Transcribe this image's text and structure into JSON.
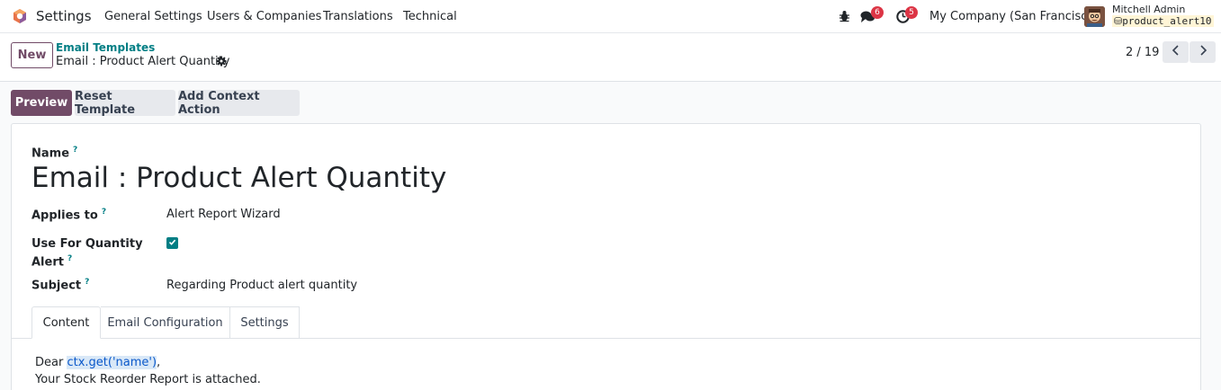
{
  "navbar": {
    "app_name": "Settings",
    "menu": [
      "General Settings",
      "Users & Companies",
      "Translations",
      "Technical"
    ],
    "messages_count": "6",
    "activities_count": "5",
    "company": "My Company (San Francisco)",
    "user_name": "Mitchell Admin",
    "database": "product_alert10"
  },
  "control_panel": {
    "new_label": "New",
    "breadcrumb_parent": "Email Templates",
    "breadcrumb_current": "Email : Product Alert Quantity",
    "pager": "2 / 19"
  },
  "actions": {
    "preview": "Preview",
    "reset": "Reset Template",
    "context": "Add Context Action"
  },
  "form": {
    "name_label": "Name",
    "name_value": "Email : Product Alert Quantity",
    "applies_label": "Applies to",
    "applies_value": "Alert Report Wizard",
    "qty_label_line1": "Use For Quantity",
    "qty_label_line2": "Alert",
    "qty_checked": true,
    "subject_label": "Subject",
    "subject_value": "Regarding Product alert quantity",
    "help_mark": "?"
  },
  "tabs": [
    "Content",
    "Email Configuration",
    "Settings"
  ],
  "content": {
    "greeting_prefix": "Dear ",
    "greeting_expr": "ctx.get('name')",
    "greeting_suffix": ",",
    "line2": "Your Stock Reorder Report is attached."
  },
  "colors": {
    "brand": "#714b67",
    "accent": "#017e84",
    "badge": "#dc3545"
  }
}
